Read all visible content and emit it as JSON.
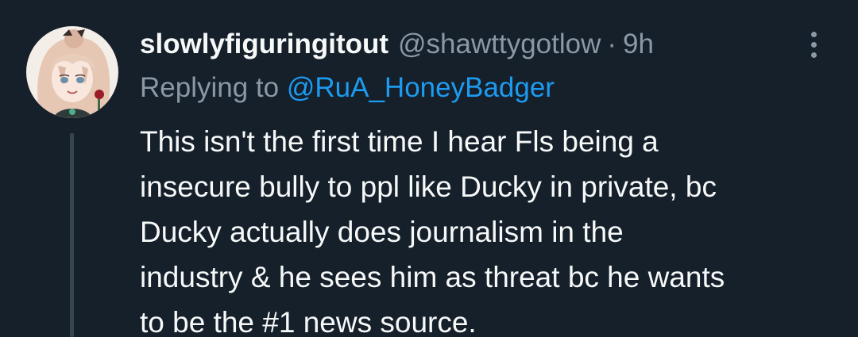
{
  "tweet": {
    "display_name": "slowlyfiguringitout",
    "handle": "@shawttygotlow",
    "separator": "·",
    "time": "9h",
    "replying_prefix": "Replying to",
    "replying_to": "@RuA_HoneyBadger",
    "text_lines": [
      "This isn't the first time I hear Fls being a",
      "insecure bully to ppl like Ducky in private, bc",
      "Ducky actually does journalism in the",
      "industry & he sees him as threat bc he wants",
      "to be the #1 news source."
    ]
  },
  "colors": {
    "background": "#15202b",
    "primary_text": "#f7f9f9",
    "secondary_text": "#8b98a5",
    "link": "#1d9bf0",
    "thread_line": "#38444d"
  },
  "icons": {
    "more": "more-vertical-icon",
    "avatar": "user-avatar-illustration"
  }
}
